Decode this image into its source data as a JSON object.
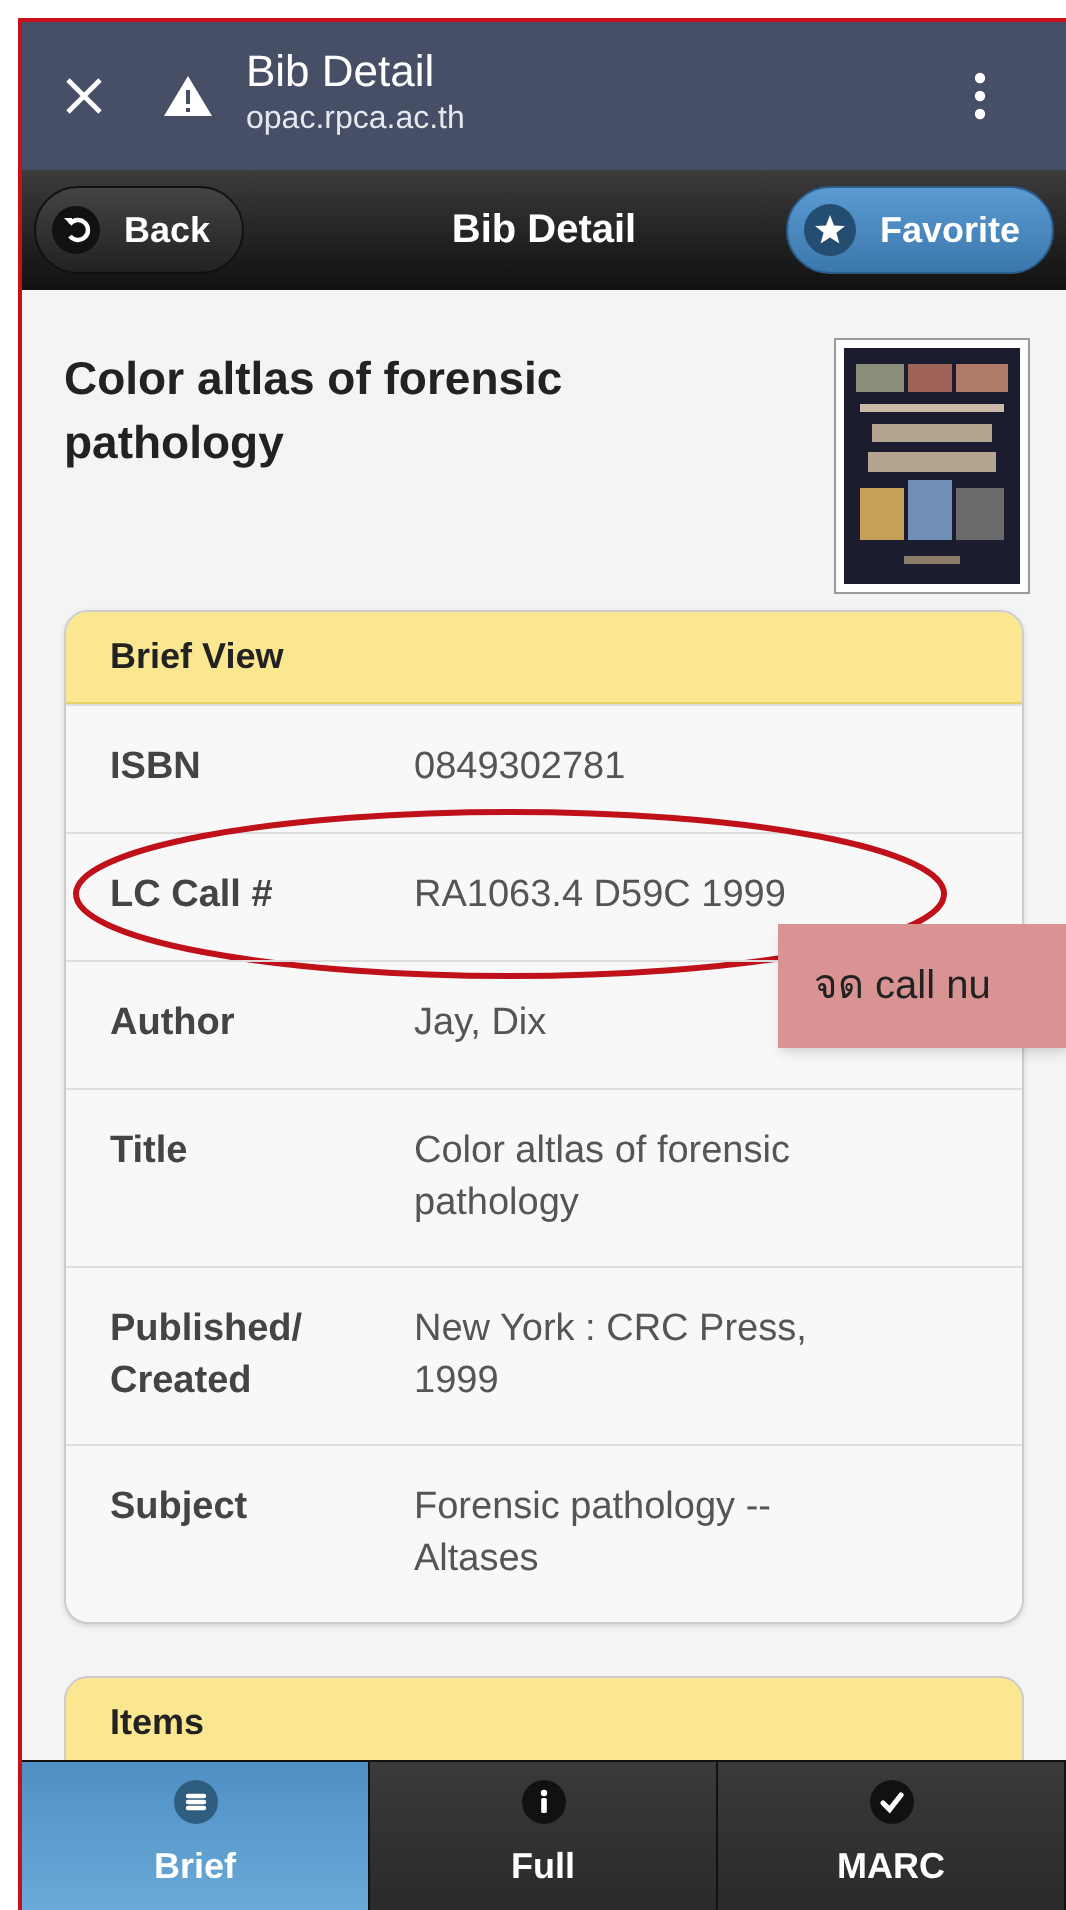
{
  "browser_bar": {
    "page_title": "Bib Detail",
    "url": "opac.rpca.ac.th"
  },
  "header": {
    "back_button": "Back",
    "title": "Bib Detail",
    "favorite_button": "Favorite"
  },
  "record": {
    "title": "Color altlas of forensic pathology"
  },
  "brief_view": {
    "heading": "Brief View",
    "rows": [
      {
        "label": "ISBN",
        "value": "0849302781",
        "circled": false
      },
      {
        "label": "LC Call #",
        "value": "RA1063.4 D59C 1999",
        "circled": true
      },
      {
        "label": "Author",
        "value": "Jay, Dix",
        "circled": false
      },
      {
        "label": "Title",
        "value": "Color altlas of forensic pathology",
        "circled": false
      },
      {
        "label": "Published/ Created",
        "value": "New York : CRC Press, 1999",
        "circled": false
      },
      {
        "label": "Subject",
        "value": "Forensic pathology -- Altases",
        "circled": false
      }
    ]
  },
  "annotation_note": "จด call nu",
  "items": {
    "heading": "Items"
  },
  "bottom_nav": [
    {
      "label": "Brief",
      "kind": "list",
      "selected": true
    },
    {
      "label": "Full",
      "kind": "info",
      "selected": false
    },
    {
      "label": "MARC",
      "kind": "check",
      "selected": false
    }
  ]
}
